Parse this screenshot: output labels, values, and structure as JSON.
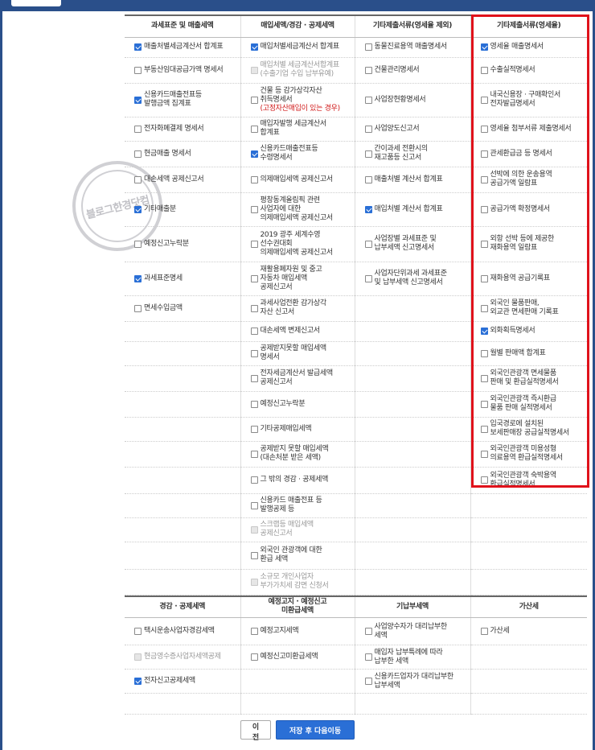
{
  "colors": {
    "accent": "#2a6fd6",
    "frame": "#2a4f8a",
    "highlight": "#e0121b",
    "red_text": "#d01818"
  },
  "watermark": {
    "text": "블로그한경닷컴"
  },
  "section1": {
    "headers": [
      "과세표준 및 매출세액",
      "매입세액/경감 · 공제세액",
      "기타제출서류(영세율 제외)",
      "기타제출서류(영세율)"
    ],
    "rows": [
      {
        "h": 25,
        "cells": [
          {
            "label": "매출처별세금계산서 합계표",
            "checked": true
          },
          {
            "label": "매입처별세금계산서 합계표",
            "checked": true
          },
          {
            "label": "동물진료용역 매출명세서",
            "checked": false
          },
          {
            "label": "영세율 매출명세서",
            "checked": true
          }
        ]
      },
      {
        "h": 32,
        "cells": [
          {
            "label": "부동산임대공급가액 명세서",
            "checked": false
          },
          {
            "label": "매입처별 세금계산서합계표\n(수출기업 수입 납부유예)",
            "checked": false,
            "disabled": true
          },
          {
            "label": "건물관리명세서",
            "checked": false
          },
          {
            "label": "수출실적명세서",
            "checked": false
          }
        ]
      },
      {
        "h": 42,
        "cells": [
          {
            "label": "신용카드매출전표등\n발행금액 집계표",
            "checked": true
          },
          {
            "label": "건물 등 감가상각자산\n취득명세서",
            "red": "(고정자산매입이 있는 경우)",
            "checked": false
          },
          {
            "label": "사업장현황명세서",
            "checked": false
          },
          {
            "label": "내국신용장 · 구매확인서\n전자발급명세서",
            "checked": false
          }
        ]
      },
      {
        "h": 30,
        "cells": [
          {
            "label": "전자화폐결제 명세서",
            "checked": false
          },
          {
            "label": "매입자발행 세금계산서\n합계표",
            "checked": false
          },
          {
            "label": "사업양도신고서",
            "checked": false
          },
          {
            "label": "영세율 첨부서류 제출명세서",
            "checked": false
          }
        ]
      },
      {
        "h": 32,
        "cells": [
          {
            "label": "현금매출 명세서",
            "checked": false
          },
          {
            "label": "신용카드매출전표등\n수령명세서",
            "checked": true
          },
          {
            "label": "간이과세 전환시의\n재고품등 신고서",
            "checked": false
          },
          {
            "label": "관세환급금 등 명세서",
            "checked": false
          }
        ]
      },
      {
        "h": 32,
        "cells": [
          {
            "label": "대손세액 공제신고서",
            "checked": false
          },
          {
            "label": "의제매입세액 공제신고서",
            "checked": false
          },
          {
            "label": "매출처별 계산서 합계표",
            "checked": false
          },
          {
            "label": "선박에 의한 운송용역\n공급가액 일람표",
            "checked": false
          }
        ]
      },
      {
        "h": 42,
        "cells": [
          {
            "label": "기타매출분",
            "checked": true
          },
          {
            "label": "평창동계올림픽 관련\n사업자에 대한\n의제매입세액 공제신고서",
            "checked": false
          },
          {
            "label": "매입처별 계산서 합계표",
            "checked": true
          },
          {
            "label": "공급가액 확정명세서",
            "checked": false
          }
        ]
      },
      {
        "h": 44,
        "cells": [
          {
            "label": "예정신고누락분",
            "checked": false
          },
          {
            "label": "2019 광주 세계수영\n선수권대회\n의제매입세액 공제신고서",
            "checked": false
          },
          {
            "label": "사업장별 과세표준 및\n납부세액 신고명세서",
            "checked": false
          },
          {
            "label": "외항 선박 등에 제공한\n재화용역 일람표",
            "checked": false
          }
        ]
      },
      {
        "h": 42,
        "cells": [
          {
            "label": "과세표준명세",
            "checked": true
          },
          {
            "label": "재활용폐자원 및 중고\n자동차 매입세액\n공제신고서",
            "checked": false
          },
          {
            "label": "사업자단위과세 과세표준\n및 납부세액 신고명세서",
            "checked": false
          },
          {
            "label": "재화용역 공급기록표",
            "checked": false
          }
        ]
      },
      {
        "h": 32,
        "cells": [
          {
            "label": "면세수입금액",
            "checked": false
          },
          {
            "label": "과세사업전환 감가상각\n자산 신고서",
            "checked": false
          },
          {
            "label": "",
            "empty": true
          },
          {
            "label": "외국인 물품판매,\n외교관 면세판매 기록표",
            "checked": false
          }
        ]
      },
      {
        "h": 25,
        "cells": [
          {
            "label": "",
            "empty": true
          },
          {
            "label": "대손세액 변제신고서",
            "checked": false
          },
          {
            "label": "",
            "empty": true
          },
          {
            "label": "외화획득명세서",
            "checked": true
          }
        ]
      },
      {
        "h": 30,
        "cells": [
          {
            "label": "",
            "empty": true
          },
          {
            "label": "공제받지못할 매입세액\n명세서",
            "checked": false
          },
          {
            "label": "",
            "empty": true
          },
          {
            "label": "월별 판매액 합계표",
            "checked": false
          }
        ]
      },
      {
        "h": 32,
        "cells": [
          {
            "label": "",
            "empty": true
          },
          {
            "label": "전자세금계산서 발급세액\n공제신고서",
            "checked": false
          },
          {
            "label": "",
            "empty": true
          },
          {
            "label": "외국인관광객 면세물품\n판매 및 환급실적명세서",
            "checked": false
          }
        ]
      },
      {
        "h": 32,
        "cells": [
          {
            "label": "",
            "empty": true
          },
          {
            "label": "예정신고누락분",
            "checked": false
          },
          {
            "label": "",
            "empty": true
          },
          {
            "label": "외국인관광객 즉시환급\n물품 판매 실적명세서",
            "checked": false
          }
        ]
      },
      {
        "h": 30,
        "cells": [
          {
            "label": "",
            "empty": true
          },
          {
            "label": "기타공제매입세액",
            "checked": false
          },
          {
            "label": "",
            "empty": true
          },
          {
            "label": "입국경로에 설치된\n보세판매장 공급실적명세서",
            "checked": false
          }
        ]
      },
      {
        "h": 32,
        "cells": [
          {
            "label": "",
            "empty": true
          },
          {
            "label": "공제받지 못할 매입세액\n(대손처분 받은 세액)",
            "checked": false
          },
          {
            "label": "",
            "empty": true
          },
          {
            "label": "외국인관광객 미용성형\n의료용역 환급실적명세서",
            "checked": false
          }
        ]
      },
      {
        "h": 33,
        "cells": [
          {
            "label": "",
            "empty": true
          },
          {
            "label": "그 밖의 경감 · 공제세액",
            "checked": false
          },
          {
            "label": "",
            "empty": true
          },
          {
            "label": "외국인관광객 숙박용역\n환급실적명세서",
            "checked": false
          }
        ]
      },
      {
        "h": 30,
        "cells": [
          {
            "label": "",
            "empty": true
          },
          {
            "label": "신용카드 매출전표 등\n발행공제 등",
            "checked": false
          },
          {
            "label": "",
            "empty": true
          },
          {
            "label": "",
            "empty": true
          }
        ]
      },
      {
        "h": 30,
        "cells": [
          {
            "label": "",
            "empty": true
          },
          {
            "label": "스크랩등 매입세액\n공제신고서",
            "checked": false,
            "disabled": true
          },
          {
            "label": "",
            "empty": true
          },
          {
            "label": "",
            "empty": true
          }
        ]
      },
      {
        "h": 34,
        "cells": [
          {
            "label": "",
            "empty": true
          },
          {
            "label": "외국인 관광객에 대한\n환급 세액",
            "checked": false
          },
          {
            "label": "",
            "empty": true
          },
          {
            "label": "",
            "empty": true
          }
        ]
      },
      {
        "h": 32,
        "cells": [
          {
            "label": "",
            "empty": true
          },
          {
            "label": "소규모 개인사업자\n부가가치세 감면 신청서",
            "checked": false,
            "disabled": true
          },
          {
            "label": "",
            "empty": true
          },
          {
            "label": "",
            "empty": true
          }
        ]
      }
    ]
  },
  "section2": {
    "headers": [
      "경감 · 공제세액",
      "예정고지 · 예정신고\n미환급세액",
      "가산세",
      "가산세"
    ],
    "headers_display": [
      "경감 · 공제세액",
      "예정고지 · 예정신고\n미환급세액",
      "기납부세액",
      "가산세"
    ],
    "rows": [
      {
        "h": 34,
        "cells": [
          {
            "label": "택시운송사업자경감세액",
            "checked": false
          },
          {
            "label": "예정고지세액",
            "checked": false
          },
          {
            "label": "사업양수자가 대리납부한\n세액",
            "checked": false
          },
          {
            "label": "가산세",
            "checked": false
          }
        ]
      },
      {
        "h": 30,
        "cells": [
          {
            "label": "현금영수증사업자세액공제",
            "checked": false,
            "disabled": true
          },
          {
            "label": "예정신고미환급세액",
            "checked": false
          },
          {
            "label": "매입자 납부특례에 따라\n납부한 세액",
            "checked": false
          },
          {
            "label": "",
            "empty": true
          }
        ]
      },
      {
        "h": 30,
        "cells": [
          {
            "label": "전자신고공제세액",
            "checked": true
          },
          {
            "label": "",
            "empty": true
          },
          {
            "label": "신용카드업자가 대리납부한\n납부세액",
            "checked": false
          },
          {
            "label": "",
            "empty": true
          }
        ]
      },
      {
        "h": 26,
        "cells": [
          {
            "label": "",
            "empty": true
          },
          {
            "label": "",
            "empty": true
          },
          {
            "label": "",
            "empty": true
          },
          {
            "label": "",
            "empty": true
          }
        ]
      }
    ]
  },
  "buttons": {
    "prev": "이전",
    "next": "저장 후 다음이동"
  }
}
